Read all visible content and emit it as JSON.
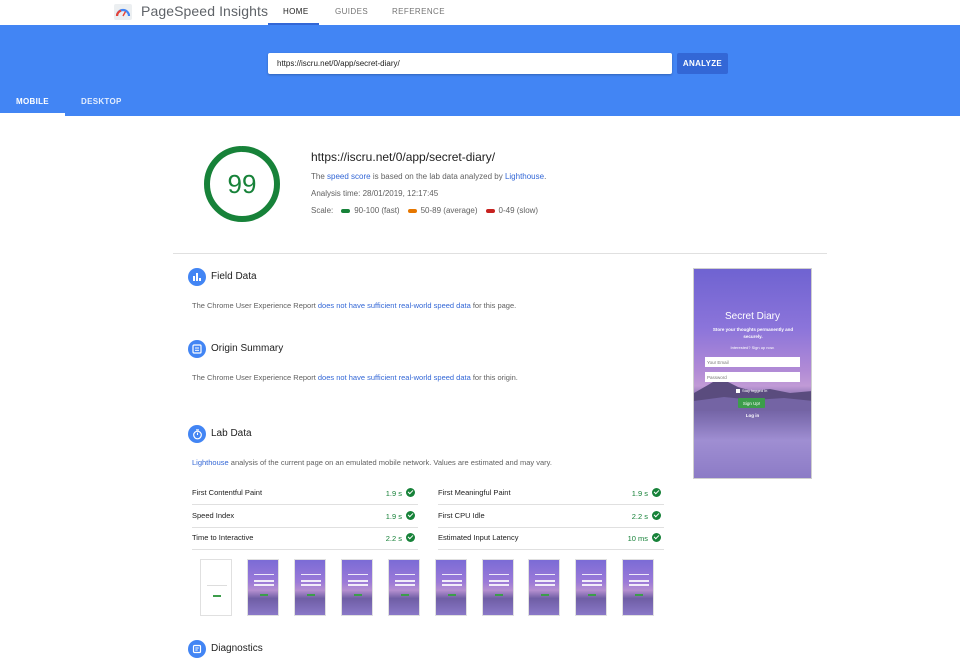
{
  "app": {
    "title": "PageSpeed Insights",
    "logo_icon": "pagespeed-gauge-icon",
    "nav": [
      "HOME",
      "GUIDES",
      "REFERENCE"
    ]
  },
  "hero": {
    "url_value": "https://iscru.net/0/app/secret-diary/",
    "analyze_label": "ANALYZE",
    "tabs": [
      "MOBILE",
      "DESKTOP"
    ],
    "active_tab": "MOBILE",
    "background": "#4285f4",
    "button_color": "#3367d6"
  },
  "score": {
    "value": "99",
    "fraction": 0.99,
    "color": "#178239",
    "url": "https://iscru.net/0/app/secret-diary/",
    "note_prefix": "The ",
    "note_link1": "speed score",
    "note_middle": " is based on the lab data analyzed by ",
    "note_link2": "Lighthouse",
    "note_suffix": ".",
    "analysis_time": "Analysis time: 28/01/2019, 12:17:45",
    "scale_label": "Scale:",
    "scale": [
      {
        "label": "90-100 (fast)",
        "color": "#178239"
      },
      {
        "label": "50-89 (average)",
        "color": "#e67700"
      },
      {
        "label": "0-49 (slow)",
        "color": "#c7221f"
      }
    ]
  },
  "field_data": {
    "title": "Field Data",
    "icon": "bar-chart-icon",
    "text_prefix": "The Chrome User Experience Report ",
    "text_link": "does not have sufficient real-world speed data",
    "text_suffix": " for this page."
  },
  "origin_summary": {
    "title": "Origin Summary",
    "icon": "summary-icon",
    "text_prefix": "The Chrome User Experience Report ",
    "text_link": "does not have sufficient real-world speed data",
    "text_suffix": " for this origin."
  },
  "lab_data": {
    "title": "Lab Data",
    "icon": "stopwatch-icon",
    "text_link": "Lighthouse",
    "text_suffix": " analysis of the current page on an emulated mobile network. Values are estimated and may vary.",
    "metrics_left": [
      {
        "label": "First Contentful Paint",
        "value": "1.9 s"
      },
      {
        "label": "Speed Index",
        "value": "1.9 s"
      },
      {
        "label": "Time to Interactive",
        "value": "2.2 s"
      }
    ],
    "metrics_right": [
      {
        "label": "First Meaningful Paint",
        "value": "1.9 s"
      },
      {
        "label": "First CPU Idle",
        "value": "2.2 s"
      },
      {
        "label": "Estimated Input Latency",
        "value": "10 ms"
      }
    ],
    "filmstrip_frames": 10
  },
  "diagnostics": {
    "title": "Diagnostics",
    "icon": "diagnostics-icon"
  },
  "preview": {
    "title": "Secret Diary",
    "subtitle": "Store your thoughts permanently and securely.",
    "signup_link": "Interested? Sign up now.",
    "email_placeholder": "Your Email",
    "password_placeholder": "Password",
    "stay_logged_in": "Stay logged in",
    "signup_button": "Sign Up!",
    "login_link": "Log in"
  }
}
